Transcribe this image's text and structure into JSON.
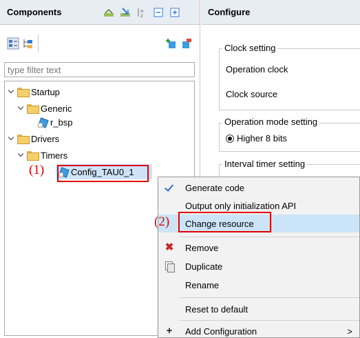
{
  "components_panel": {
    "title": "Components",
    "filter_placeholder": "type filter text",
    "tree": [
      {
        "label": "Startup",
        "type": "folder"
      },
      {
        "label": "Generic",
        "type": "folder"
      },
      {
        "label": "r_bsp",
        "type": "component"
      },
      {
        "label": "Drivers",
        "type": "folder"
      },
      {
        "label": "Timers",
        "type": "folder"
      },
      {
        "label": "Config_TAU0_1",
        "type": "component",
        "selected": true
      }
    ]
  },
  "configure_panel": {
    "title": "Configure",
    "clock_group": "Clock setting",
    "operation_clock": "Operation clock",
    "clock_source": "Clock source",
    "mode_group": "Operation mode setting",
    "mode_option": "Higher 8 bits",
    "interval_group": "Interval timer setting"
  },
  "context_menu": {
    "items": [
      {
        "label": "Generate code",
        "icon": "check-icon"
      },
      {
        "label": "Output only initialization API",
        "icon": ""
      },
      {
        "label": "Change resource",
        "icon": "",
        "hovered": true
      },
      {
        "label": "Remove",
        "icon": "remove-icon"
      },
      {
        "label": "Duplicate",
        "icon": "duplicate-icon"
      },
      {
        "label": "Rename",
        "icon": ""
      },
      {
        "label": "Reset to default",
        "icon": ""
      },
      {
        "label": "Add Configuration",
        "icon": "plus-icon",
        "submenu_arrow": ">"
      }
    ]
  },
  "annotations": {
    "step1": "(1)",
    "step2": "(2)",
    "color": "#e00000"
  },
  "colors": {
    "header_bg": "#e8ecf3",
    "selection": "#cfe3f7",
    "menu_hover": "#cce4f7"
  }
}
